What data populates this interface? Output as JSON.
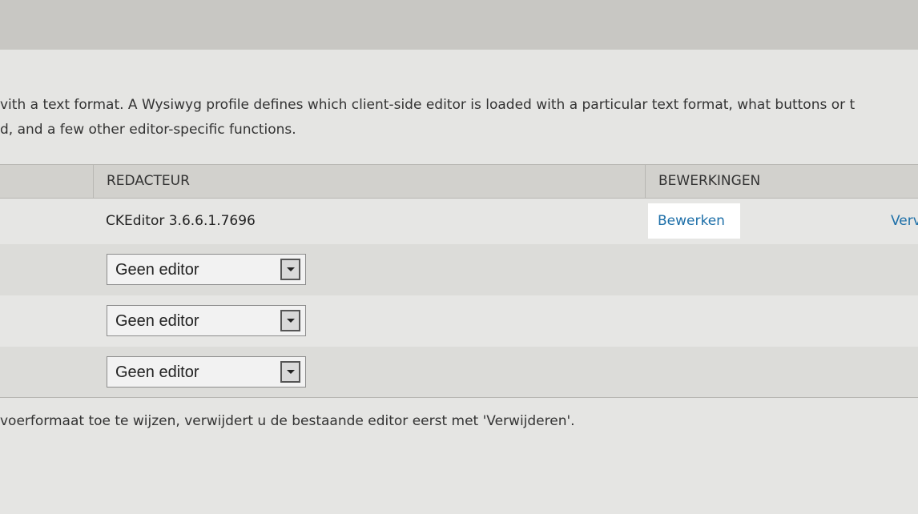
{
  "description": {
    "line1": "vith a text format. A Wysiwyg profile defines which client-side editor is loaded with a particular text format, what buttons or t",
    "line2": "d, and a few other editor-specific functions."
  },
  "table": {
    "headers": {
      "editor": "REDACTEUR",
      "operations": "BEWERKINGEN"
    },
    "rows": [
      {
        "editor": "CKEditor 3.6.6.1.7696",
        "edit_label": "Bewerken",
        "delete_label": "Verv"
      },
      {
        "select_value": "Geen editor"
      },
      {
        "select_value": "Geen editor"
      },
      {
        "select_value": "Geen editor"
      }
    ]
  },
  "note": "voerformaat toe te wijzen, verwijdert u de bestaande editor eerst met 'Verwijderen'.",
  "colors": {
    "link": "#1d6fa8",
    "top_bar": "#c8c7c3",
    "background": "#e5e5e3"
  }
}
